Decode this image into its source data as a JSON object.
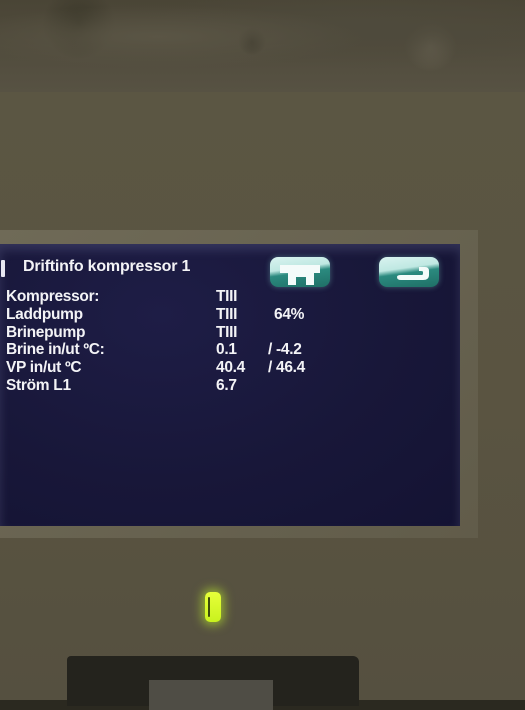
{
  "screen": {
    "title": "Driftinfo kompressor 1",
    "buttons": {
      "home": {
        "icon": "home-icon"
      },
      "back": {
        "icon": "return-arrow-icon"
      }
    },
    "rows": [
      {
        "label": "Kompressor:",
        "value1": "TIII",
        "value2": ""
      },
      {
        "label": "Laddpump",
        "value1": "TIII",
        "value2": "64%"
      },
      {
        "label": "Brinepump",
        "value1": "TIII",
        "value2": ""
      },
      {
        "label": "Brine in/ut ºC:",
        "value1": "0.1",
        "value2": "/ -4.2"
      },
      {
        "label": "VP in/ut ºC",
        "value1": "40.4",
        "value2": "/ 46.4"
      },
      {
        "label": "Ström L1",
        "value1": "6.7",
        "value2": ""
      }
    ]
  },
  "colors": {
    "screen_background": "#181739",
    "text": "#f3f3f6",
    "button_teal": "#2b8a7f",
    "led_green": "#d4f52a",
    "panel": "#5a5441"
  },
  "status_led": {
    "state": "on",
    "color": "green"
  }
}
